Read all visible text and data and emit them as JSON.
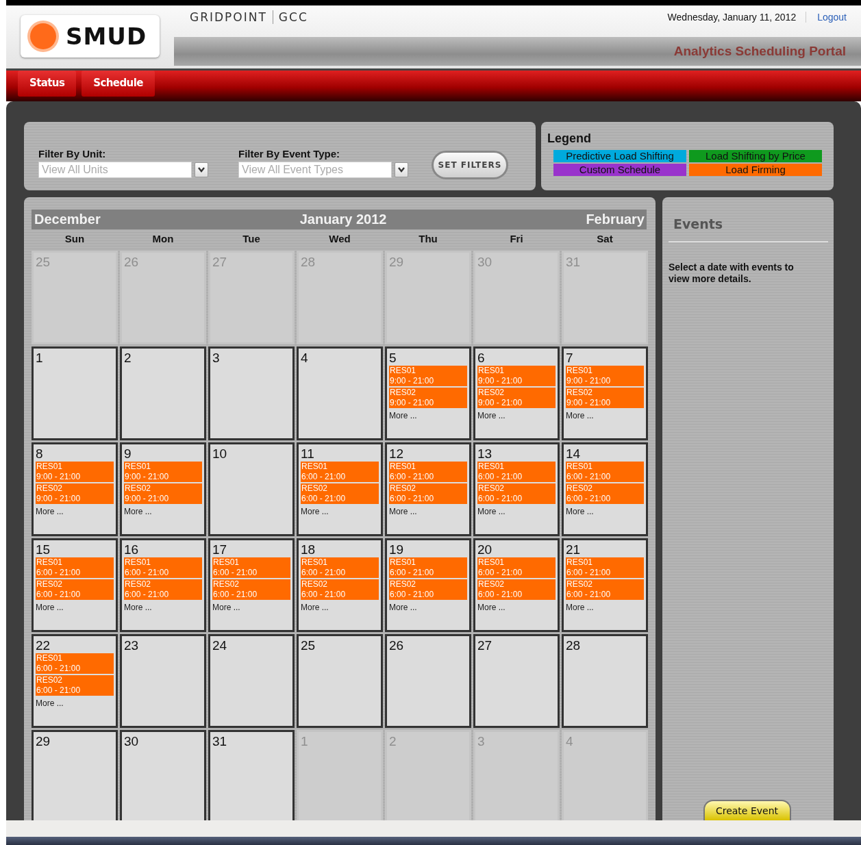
{
  "header": {
    "logo": "SMUD",
    "product": "GRIDPOINT",
    "product_suffix": "GCC",
    "date": "Wednesday, January 11, 2012",
    "logout": "Logout",
    "portal_title": "Analytics Scheduling Portal"
  },
  "nav": [
    {
      "label": "Status"
    },
    {
      "label": "Schedule"
    }
  ],
  "filters": [
    {
      "label": "Filter By Unit:",
      "placeholder": "View All Units"
    },
    {
      "label": "Filter By Event Type:",
      "placeholder": "View All Event Types"
    }
  ],
  "set_filters": "SET FILTERS",
  "legend": {
    "title": "Legend",
    "items": [
      {
        "label": "Predictive Load Shifting",
        "color": "#00aadd"
      },
      {
        "label": "Load Shifting by Price",
        "color": "#0f9a1e"
      },
      {
        "label": "Custom Schedule",
        "color": "#9933cc"
      },
      {
        "label": "Load Firming",
        "color": "#ff6a00"
      }
    ]
  },
  "calendar": {
    "prev_month": "December",
    "title": "January 2012",
    "next_month": "February",
    "weekdays": [
      "Sun",
      "Mon",
      "Tue",
      "Wed",
      "Thu",
      "Fri",
      "Sat"
    ],
    "weeks": [
      [
        {
          "day": "25",
          "in_month": false
        },
        {
          "day": "26",
          "in_month": false
        },
        {
          "day": "27",
          "in_month": false
        },
        {
          "day": "28",
          "in_month": false
        },
        {
          "day": "29",
          "in_month": false
        },
        {
          "day": "30",
          "in_month": false
        },
        {
          "day": "31",
          "in_month": false
        }
      ],
      [
        {
          "day": "1",
          "in_month": true
        },
        {
          "day": "2",
          "in_month": true
        },
        {
          "day": "3",
          "in_month": true
        },
        {
          "day": "4",
          "in_month": true
        },
        {
          "day": "5",
          "in_month": true,
          "events": [
            {
              "unit": "RES01",
              "time": "9:00 - 21:00",
              "color": "#ff6a00"
            },
            {
              "unit": "RES02",
              "time": "9:00 - 21:00",
              "color": "#ff6a00"
            }
          ],
          "more": "More ..."
        },
        {
          "day": "6",
          "in_month": true,
          "events": [
            {
              "unit": "RES01",
              "time": "9:00 - 21:00",
              "color": "#ff6a00"
            },
            {
              "unit": "RES02",
              "time": "9:00 - 21:00",
              "color": "#ff6a00"
            }
          ],
          "more": "More ..."
        },
        {
          "day": "7",
          "in_month": true,
          "events": [
            {
              "unit": "RES01",
              "time": "9:00 - 21:00",
              "color": "#ff6a00"
            },
            {
              "unit": "RES02",
              "time": "9:00 - 21:00",
              "color": "#ff6a00"
            }
          ],
          "more": "More ..."
        }
      ],
      [
        {
          "day": "8",
          "in_month": true,
          "events": [
            {
              "unit": "RES01",
              "time": "9:00 - 21:00",
              "color": "#ff6a00"
            },
            {
              "unit": "RES02",
              "time": "9:00 - 21:00",
              "color": "#ff6a00"
            }
          ],
          "more": "More ..."
        },
        {
          "day": "9",
          "in_month": true,
          "events": [
            {
              "unit": "RES01",
              "time": "9:00 - 21:00",
              "color": "#ff6a00"
            },
            {
              "unit": "RES02",
              "time": "9:00 - 21:00",
              "color": "#ff6a00"
            }
          ],
          "more": "More ..."
        },
        {
          "day": "10",
          "in_month": true
        },
        {
          "day": "11",
          "in_month": true,
          "events": [
            {
              "unit": "RES01",
              "time": "6:00 - 21:00",
              "color": "#ff6a00"
            },
            {
              "unit": "RES02",
              "time": "6:00 - 21:00",
              "color": "#ff6a00"
            }
          ],
          "more": "More ..."
        },
        {
          "day": "12",
          "in_month": true,
          "events": [
            {
              "unit": "RES01",
              "time": "6:00 - 21:00",
              "color": "#ff6a00"
            },
            {
              "unit": "RES02",
              "time": "6:00 - 21:00",
              "color": "#ff6a00"
            }
          ],
          "more": "More ..."
        },
        {
          "day": "13",
          "in_month": true,
          "events": [
            {
              "unit": "RES01",
              "time": "6:00 - 21:00",
              "color": "#ff6a00"
            },
            {
              "unit": "RES02",
              "time": "6:00 - 21:00",
              "color": "#ff6a00"
            }
          ],
          "more": "More ..."
        },
        {
          "day": "14",
          "in_month": true,
          "events": [
            {
              "unit": "RES01",
              "time": "6:00 - 21:00",
              "color": "#ff6a00"
            },
            {
              "unit": "RES02",
              "time": "6:00 - 21:00",
              "color": "#ff6a00"
            }
          ],
          "more": "More ..."
        }
      ],
      [
        {
          "day": "15",
          "in_month": true,
          "events": [
            {
              "unit": "RES01",
              "time": "6:00 - 21:00",
              "color": "#ff6a00"
            },
            {
              "unit": "RES02",
              "time": "6:00 - 21:00",
              "color": "#ff6a00"
            }
          ],
          "more": "More ..."
        },
        {
          "day": "16",
          "in_month": true,
          "events": [
            {
              "unit": "RES01",
              "time": "6:00 - 21:00",
              "color": "#ff6a00"
            },
            {
              "unit": "RES02",
              "time": "6:00 - 21:00",
              "color": "#ff6a00"
            }
          ],
          "more": "More ..."
        },
        {
          "day": "17",
          "in_month": true,
          "events": [
            {
              "unit": "RES01",
              "time": "6:00 - 21:00",
              "color": "#ff6a00"
            },
            {
              "unit": "RES02",
              "time": "6:00 - 21:00",
              "color": "#ff6a00"
            }
          ],
          "more": "More ..."
        },
        {
          "day": "18",
          "in_month": true,
          "events": [
            {
              "unit": "RES01",
              "time": "6:00 - 21:00",
              "color": "#ff6a00"
            },
            {
              "unit": "RES02",
              "time": "6:00 - 21:00",
              "color": "#ff6a00"
            }
          ],
          "more": "More ..."
        },
        {
          "day": "19",
          "in_month": true,
          "events": [
            {
              "unit": "RES01",
              "time": "6:00 - 21:00",
              "color": "#ff6a00"
            },
            {
              "unit": "RES02",
              "time": "6:00 - 21:00",
              "color": "#ff6a00"
            }
          ],
          "more": "More ..."
        },
        {
          "day": "20",
          "in_month": true,
          "events": [
            {
              "unit": "RES01",
              "time": "6:00 - 21:00",
              "color": "#ff6a00"
            },
            {
              "unit": "RES02",
              "time": "6:00 - 21:00",
              "color": "#ff6a00"
            }
          ],
          "more": "More ..."
        },
        {
          "day": "21",
          "in_month": true,
          "events": [
            {
              "unit": "RES01",
              "time": "6:00 - 21:00",
              "color": "#ff6a00"
            },
            {
              "unit": "RES02",
              "time": "6:00 - 21:00",
              "color": "#ff6a00"
            }
          ],
          "more": "More ..."
        }
      ],
      [
        {
          "day": "22",
          "in_month": true,
          "events": [
            {
              "unit": "RES01",
              "time": "6:00 - 21:00",
              "color": "#ff6a00"
            },
            {
              "unit": "RES02",
              "time": "6:00 - 21:00",
              "color": "#ff6a00"
            }
          ],
          "more": "More ..."
        },
        {
          "day": "23",
          "in_month": true
        },
        {
          "day": "24",
          "in_month": true
        },
        {
          "day": "25",
          "in_month": true
        },
        {
          "day": "26",
          "in_month": true
        },
        {
          "day": "27",
          "in_month": true
        },
        {
          "day": "28",
          "in_month": true
        }
      ],
      [
        {
          "day": "29",
          "in_month": true
        },
        {
          "day": "30",
          "in_month": true
        },
        {
          "day": "31",
          "in_month": true
        },
        {
          "day": "1",
          "in_month": false
        },
        {
          "day": "2",
          "in_month": false
        },
        {
          "day": "3",
          "in_month": false
        },
        {
          "day": "4",
          "in_month": false
        }
      ]
    ]
  },
  "events_panel": {
    "title": "Events",
    "message": "Select a date with events to view more details.",
    "create_button": "Create Event"
  }
}
